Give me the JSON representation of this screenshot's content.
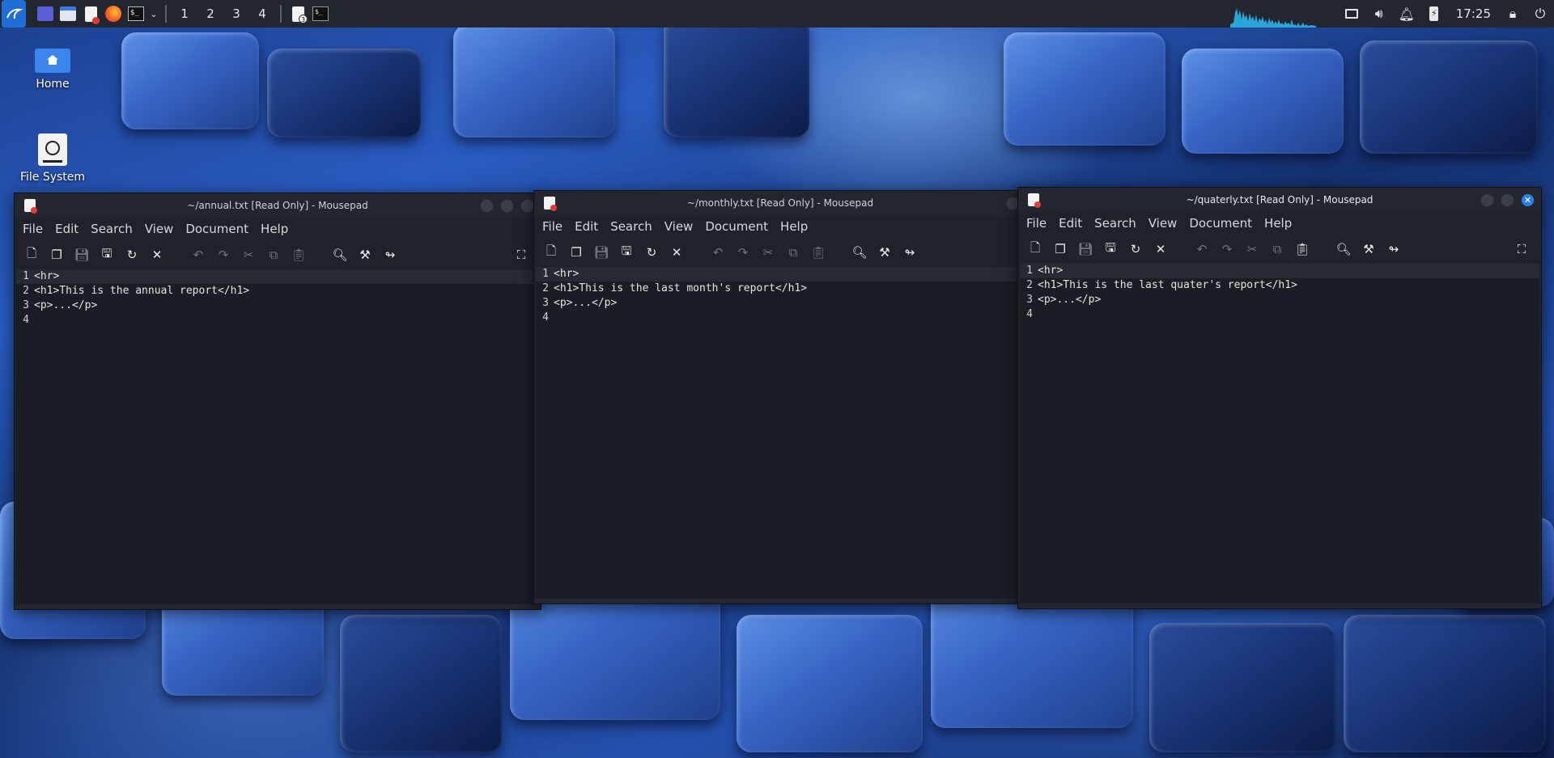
{
  "panel": {
    "workspaces": [
      "1",
      "2",
      "3",
      "4"
    ],
    "clock": "17:25",
    "task_badge": "3"
  },
  "desktop": {
    "icons": [
      {
        "label": "Home",
        "icon": "home-folder-icon"
      },
      {
        "label": "File System",
        "icon": "drive-icon"
      }
    ]
  },
  "menu": [
    "File",
    "Edit",
    "Search",
    "View",
    "Document",
    "Help"
  ],
  "windows": [
    {
      "title": "~/annual.txt [Read Only] - Mousepad",
      "lines": [
        {
          "n": "1",
          "text": "<hr>"
        },
        {
          "n": "2",
          "text": "<h1>This is the annual report</h1>"
        },
        {
          "n": "3",
          "text": "<p>...</p>"
        },
        {
          "n": "4",
          "text": ""
        }
      ]
    },
    {
      "title": "~/monthly.txt [Read Only] - Mousepad",
      "lines": [
        {
          "n": "1",
          "text": "<hr>"
        },
        {
          "n": "2",
          "text": "<h1>This is the last month's report</h1>"
        },
        {
          "n": "3",
          "text": "<p>...</p>"
        },
        {
          "n": "4",
          "text": ""
        }
      ]
    },
    {
      "title": "~/quaterly.txt [Read Only] - Mousepad",
      "lines": [
        {
          "n": "1",
          "text": "<hr>"
        },
        {
          "n": "2",
          "text": "<h1>This is the last quater's report</h1>"
        },
        {
          "n": "3",
          "text": "<p>...</p>"
        },
        {
          "n": "4",
          "text": ""
        }
      ]
    }
  ],
  "colors": {
    "panel": "#22262e",
    "window": "#1f2229",
    "editor": "#1a1d23",
    "accent": "#2a7fe0"
  }
}
